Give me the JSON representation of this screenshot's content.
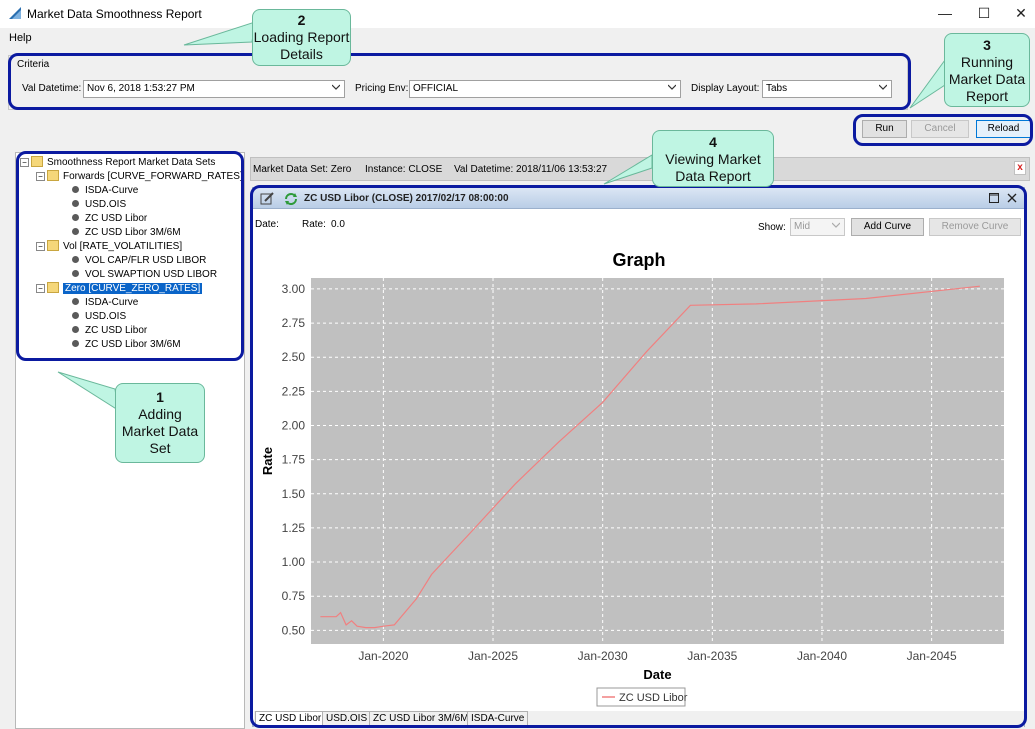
{
  "window": {
    "title": "Market Data Smoothness Report",
    "minimize": "—",
    "maximize": "☐",
    "close": "✕"
  },
  "menu": {
    "help": "Help"
  },
  "criteria": {
    "title": "Criteria",
    "val_datetime_label": "Val Datetime:",
    "val_datetime_value": "Nov 6, 2018 1:53:27 PM",
    "pricing_env_label": "Pricing Env:",
    "pricing_env_value": "OFFICIAL",
    "display_layout_label": "Display Layout:",
    "display_layout_value": "Tabs"
  },
  "actions": {
    "run": "Run",
    "cancel": "Cancel",
    "reload": "Reload"
  },
  "tree": {
    "root": "Smoothness Report Market Data Sets",
    "forwards": {
      "label": "Forwards  [CURVE_FORWARD_RATES]",
      "items": [
        "ISDA-Curve",
        "USD.OIS",
        "ZC USD Libor",
        "ZC USD Libor 3M/6M"
      ]
    },
    "vol": {
      "label": "Vol  [RATE_VOLATILITIES]",
      "items": [
        "VOL CAP/FLR USD LIBOR",
        "VOL SWAPTION USD LIBOR"
      ]
    },
    "zero": {
      "label": "Zero  [CURVE_ZERO_RATES]",
      "items": [
        "ISDA-Curve",
        "USD.OIS",
        "ZC USD Libor",
        "ZC USD Libor 3M/6M"
      ]
    }
  },
  "dataset_bar": {
    "market_data_set": "Market Data Set: Zero",
    "instance": "Instance: CLOSE",
    "val_datetime": "Val Datetime: 2018/11/06 13:53:27",
    "close": "x"
  },
  "report": {
    "title": "ZC USD Libor   (CLOSE) 2017/02/17 08:00:00",
    "date_label": "Date:",
    "rate_label": "Rate:",
    "rate_value": "0.0",
    "show_label": "Show:",
    "show_value": "Mid",
    "add_curve": "Add Curve",
    "remove_curve": "Remove Curve",
    "tabs": [
      "ZC USD Libor",
      "USD.OIS",
      "ZC USD Libor 3M/6M",
      "ISDA-Curve"
    ]
  },
  "chart_data": {
    "type": "line",
    "title": "Graph",
    "xlabel": "Date",
    "ylabel": "Rate",
    "x_ticks": [
      "Jan-2020",
      "Jan-2025",
      "Jan-2030",
      "Jan-2035",
      "Jan-2040",
      "Jan-2045"
    ],
    "y_ticks": [
      "0.50",
      "0.75",
      "1.00",
      "1.25",
      "1.50",
      "1.75",
      "2.00",
      "2.25",
      "2.50",
      "2.75",
      "3.00"
    ],
    "xlim": [
      2016.7,
      2048.3
    ],
    "ylim": [
      0.4,
      3.08
    ],
    "grid": true,
    "legend": "bottom-center",
    "series": [
      {
        "name": "ZC USD Libor",
        "color": "#f08080",
        "x": [
          2017.13,
          2017.6,
          2017.85,
          2018.05,
          2018.3,
          2018.55,
          2018.8,
          2019.2,
          2019.6,
          2020.0,
          2020.5,
          2021.5,
          2022.2,
          2024.0,
          2026.0,
          2028.0,
          2030.0,
          2032.0,
          2034.0,
          2037.0,
          2042.0,
          2047.2
        ],
        "y": [
          0.6,
          0.6,
          0.6,
          0.63,
          0.54,
          0.57,
          0.53,
          0.52,
          0.52,
          0.53,
          0.54,
          0.73,
          0.91,
          1.22,
          1.57,
          1.88,
          2.17,
          2.54,
          2.88,
          2.89,
          2.93,
          3.02
        ]
      }
    ],
    "bg": "#c0c0c0",
    "grid_color": "#ffffff"
  },
  "callouts": {
    "c1": {
      "num": "1",
      "text": "Adding Market Data Set"
    },
    "c2": {
      "num": "2",
      "text": "Loading Report Details"
    },
    "c3": {
      "num": "3",
      "text": "Running Market Data Report"
    },
    "c4": {
      "num": "4",
      "text": "Viewing Market Data Report"
    }
  }
}
